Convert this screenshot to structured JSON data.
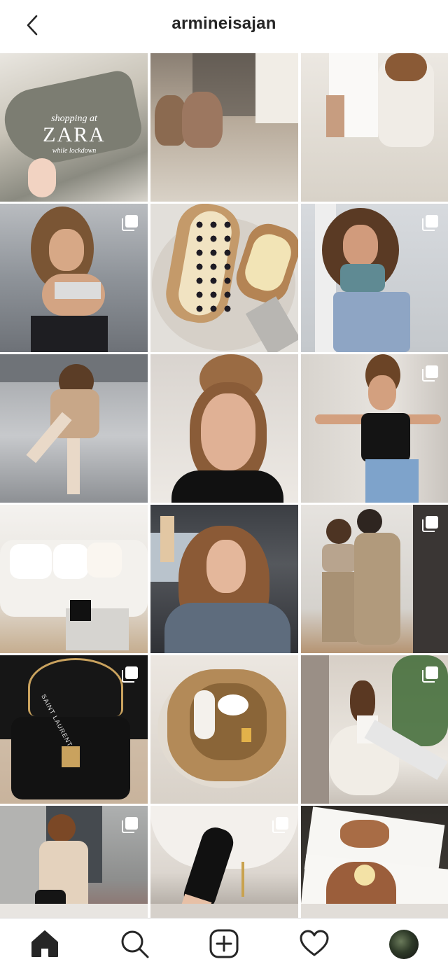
{
  "header": {
    "username": "armineisajan"
  },
  "tiles": [
    {
      "name": "post-shopping-zara",
      "multi": false,
      "overlay": {
        "line1": "shopping at",
        "line2": "ZARA",
        "line3": "while lockdown"
      }
    },
    {
      "name": "post-vases-room",
      "multi": false
    },
    {
      "name": "post-couple-white-shirt",
      "multi": false
    },
    {
      "name": "post-curly-hair-parking",
      "multi": true
    },
    {
      "name": "post-blackberry-toast",
      "multi": false
    },
    {
      "name": "post-blue-top-jeans",
      "multi": true
    },
    {
      "name": "post-beige-outfit-parking",
      "multi": false
    },
    {
      "name": "post-selfie-updo",
      "multi": false
    },
    {
      "name": "post-black-halter-top",
      "multi": true
    },
    {
      "name": "post-living-room-sofa",
      "multi": false
    },
    {
      "name": "post-car-selfie",
      "multi": false
    },
    {
      "name": "post-couple-mirror",
      "multi": true
    },
    {
      "name": "post-saint-laurent-bag",
      "multi": true,
      "overlay": {
        "line1": "SAINT LAURENT"
      }
    },
    {
      "name": "post-gold-clutch",
      "multi": false
    },
    {
      "name": "post-white-chair",
      "multi": true
    },
    {
      "name": "post-trench-coat",
      "multi": true
    },
    {
      "name": "post-black-sock-boot",
      "multi": true
    },
    {
      "name": "post-banana-pancakes",
      "multi": false
    }
  ],
  "tabbar": {
    "items": [
      {
        "name": "home",
        "icon": "home-icon",
        "active": true
      },
      {
        "name": "search",
        "icon": "search-icon",
        "active": false
      },
      {
        "name": "new-post",
        "icon": "plus-square-icon",
        "active": false
      },
      {
        "name": "activity",
        "icon": "heart-icon",
        "active": false
      },
      {
        "name": "profile",
        "icon": "avatar",
        "active": false
      }
    ]
  },
  "colors": {
    "text": "#262626",
    "border": "#dbdbdb",
    "background": "#ffffff"
  }
}
